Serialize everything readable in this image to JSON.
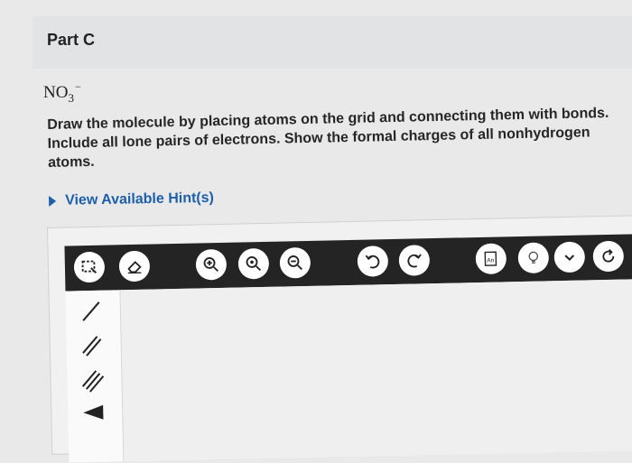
{
  "part": {
    "title": "Part C"
  },
  "formula": {
    "base": "NO",
    "subscript": "3",
    "superscript": "−"
  },
  "instructions": "Draw the molecule by placing atoms on the grid and connecting them with bonds. Include all lone pairs of electrons. Show the formal charges of all nonhydrogen atoms.",
  "hint": {
    "label": "View Available Hint(s)"
  },
  "colors": {
    "link": "#1d5fa8",
    "toolbar": "#242424"
  },
  "toolbar": {
    "tools": [
      "select-icon",
      "eraser-icon",
      "zoom-in-icon",
      "zoom-reset-icon",
      "zoom-out-icon",
      "undo-icon",
      "redo-icon",
      "template-icon",
      "info-icon",
      "chevron-down-icon",
      "reset-icon"
    ]
  },
  "bond_tools": [
    "single-bond-icon",
    "double-bond-icon",
    "triple-bond-icon",
    "wedge-bond-icon"
  ]
}
